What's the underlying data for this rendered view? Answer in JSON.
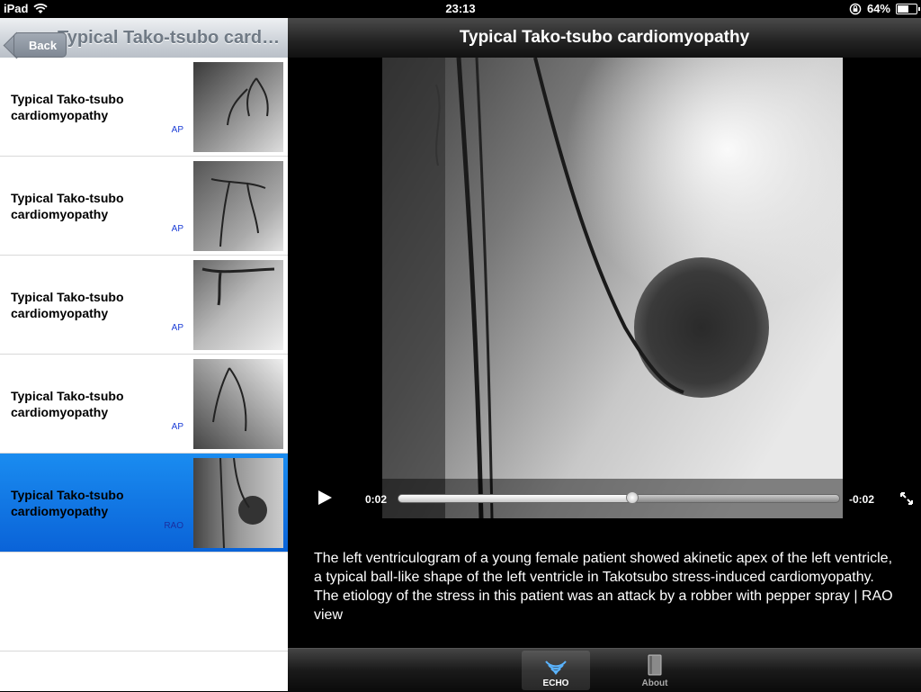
{
  "status_bar": {
    "device": "iPad",
    "time": "23:13",
    "battery": "64%",
    "battery_level": 0.64
  },
  "left_pane": {
    "back_label": "Back",
    "title": "Typical Tako-tsubo cardiomyopathy",
    "items": [
      {
        "title": "Typical Tako-tsubo cardiomyopathy",
        "view": "AP",
        "selected": false
      },
      {
        "title": "Typical Tako-tsubo cardiomyopathy",
        "view": "AP",
        "selected": false
      },
      {
        "title": "Typical Tako-tsubo cardiomyopathy",
        "view": "AP",
        "selected": false
      },
      {
        "title": "Typical Tako-tsubo cardiomyopathy",
        "view": "AP",
        "selected": false
      },
      {
        "title": "Typical Tako-tsubo cardiomyopathy",
        "view": "RAO",
        "selected": true
      }
    ]
  },
  "detail": {
    "title": "Typical Tako-tsubo cardiomyopathy",
    "player": {
      "elapsed": "0:02",
      "remaining": "-0:02",
      "progress": 0.53
    },
    "description": "The left ventriculogram of a young female patient showed akinetic apex of the left ventricle, a typical ball-like shape of the left ventricle in Takotsubo stress-induced cardiomyopathy. The etiology of the stress in this patient was an attack by a robber with pepper spray | RAO view"
  },
  "tabbar": {
    "tabs": [
      {
        "label": "ECHO",
        "icon": "echo-waves-icon",
        "active": true
      },
      {
        "label": "About",
        "icon": "book-icon",
        "active": false
      }
    ]
  },
  "colors": {
    "selection_blue": "#0a63d8",
    "view_label_blue": "#1a3cd6"
  }
}
